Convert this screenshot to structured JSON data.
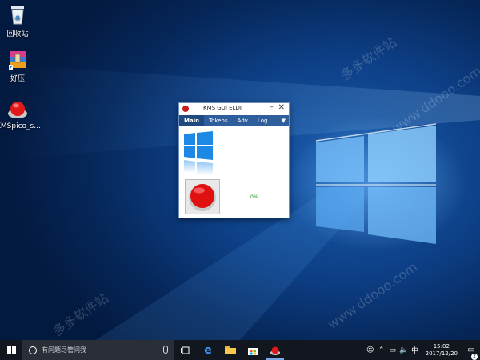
{
  "desktop": {
    "icons": [
      {
        "label": "回收站",
        "icon": "recycle-bin-icon"
      },
      {
        "label": "好压",
        "icon": "winrar-archive-icon"
      },
      {
        "label": "KMSpico_s...",
        "icon": "kmspico-red-button-icon"
      }
    ],
    "watermarks": [
      "多多软件站",
      "www.ddooo.com",
      "多多软件站",
      "www.ddooo.com"
    ]
  },
  "kms_window": {
    "title": "KMS GUI ELDI",
    "tabs": [
      "Main",
      "Tokens",
      "Adv",
      "Log"
    ],
    "active_tab": "Main",
    "progress_text": "0%",
    "minimize": "–",
    "close": "✕",
    "dropdown": "▼"
  },
  "taskbar": {
    "search_placeholder": "有问题尽管问我",
    "tray": {
      "time": "15:02",
      "date": "2017/12/20",
      "notifications": "2",
      "ime": "中"
    }
  },
  "colors": {
    "desktop_blue": "#0d3f86",
    "tab_bar": "#2e5e9c",
    "taskbar": "#12161f",
    "activate_red": "#e01010",
    "progress_green": "#1a8a1a"
  }
}
